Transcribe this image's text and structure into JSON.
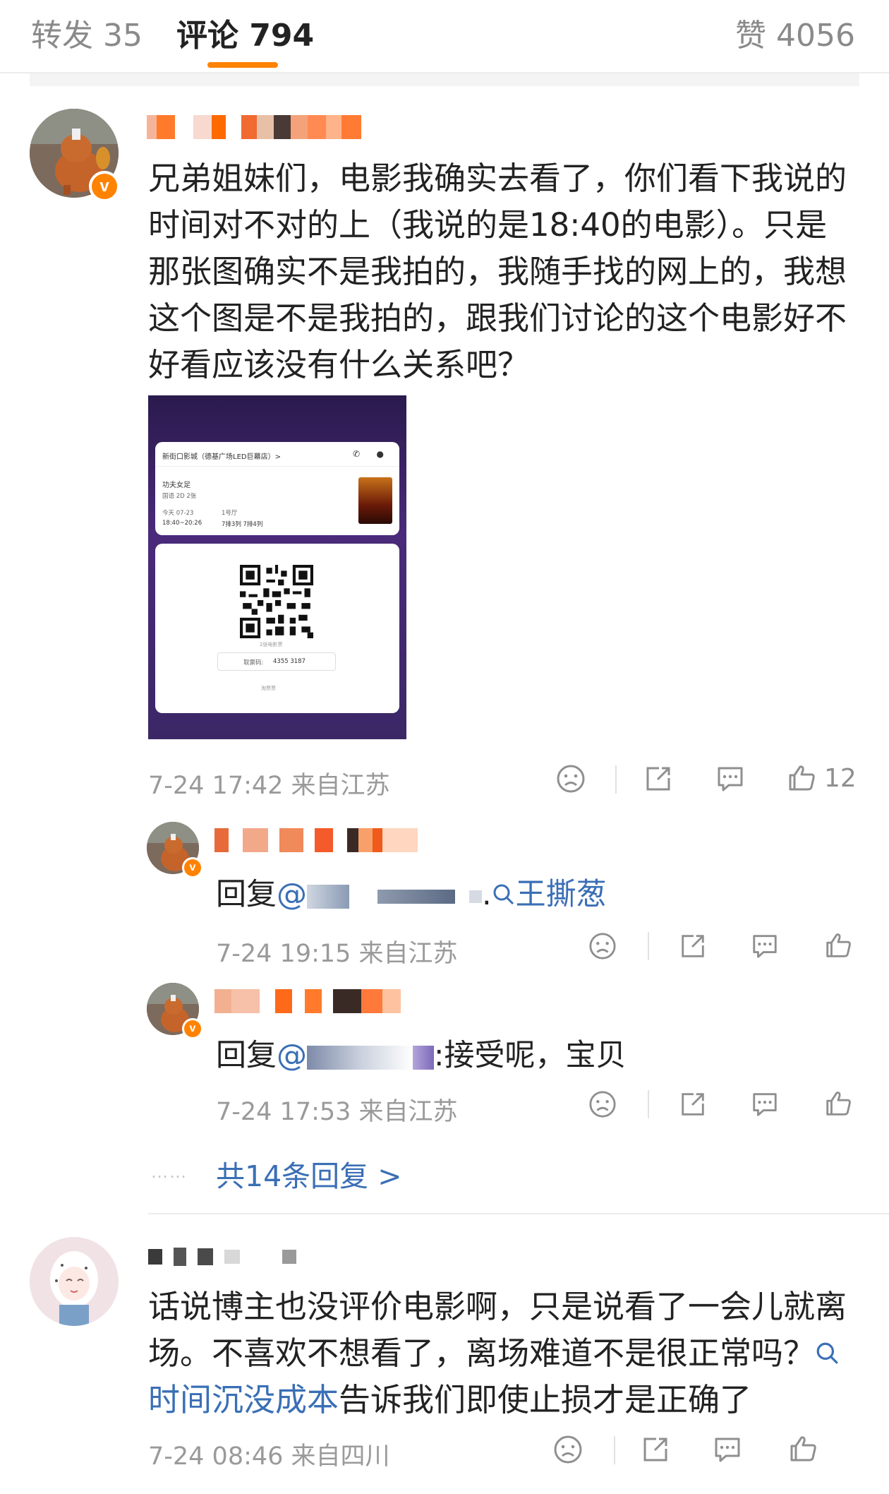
{
  "tabs": {
    "repost": "转发 35",
    "comment": "评论 794",
    "like": "赞 4056"
  },
  "comment1": {
    "text": "兄弟姐妹们，电影我确实去看了，你们看下我说的时间对不对的上（我说的是18:40的电影）。只是那张图确实不是我拍的，我随手找的网上的，我想这个图是不是我拍的，跟我们讨论的这个电影好不好看应该没有什么关系吧？",
    "meta": "7-24 17:42  来自江苏",
    "like_count": "12",
    "ticket": {
      "cinema": "新街口影城（德基广场LED巨幕店）>",
      "movie": "功夫女足",
      "format": "国语 2D 2张",
      "date": "今天 07-23",
      "time": "18:40~20:26",
      "hall": "1号厅",
      "seats": "7排3列 7排4列",
      "ticket_count": "2张电影票",
      "code_label": "取票码: ",
      "code": "4355 3187",
      "brand": "淘票票"
    }
  },
  "reply1": {
    "prefix": "回复",
    "at": "@",
    "dot": ".",
    "search_term": "王撕葱",
    "meta": "7-24 19:15  来自江苏"
  },
  "reply2": {
    "prefix": "回复",
    "at": "@",
    "text": ":接受呢，宝贝",
    "meta": "7-24 17:53  来自江苏"
  },
  "more_replies": "共14条回复 >",
  "dots": "……",
  "comment2": {
    "text_part1": "话说博主也没评价电影啊，只是说看了一会儿就离场。不喜欢不想看了，离场难道不是很正常吗？",
    "search_term": "时间沉没成本",
    "text_part2": "告诉我们即使止损才是正确了",
    "meta": "7-24 08:46  来自四川"
  },
  "colors": {
    "accent": "#ff8200",
    "link": "#3a6fb5",
    "meta": "#9a9a9a"
  },
  "icons": [
    "dislike-icon",
    "share-icon",
    "comment-icon",
    "like-icon",
    "search-icon",
    "verified-icon"
  ]
}
